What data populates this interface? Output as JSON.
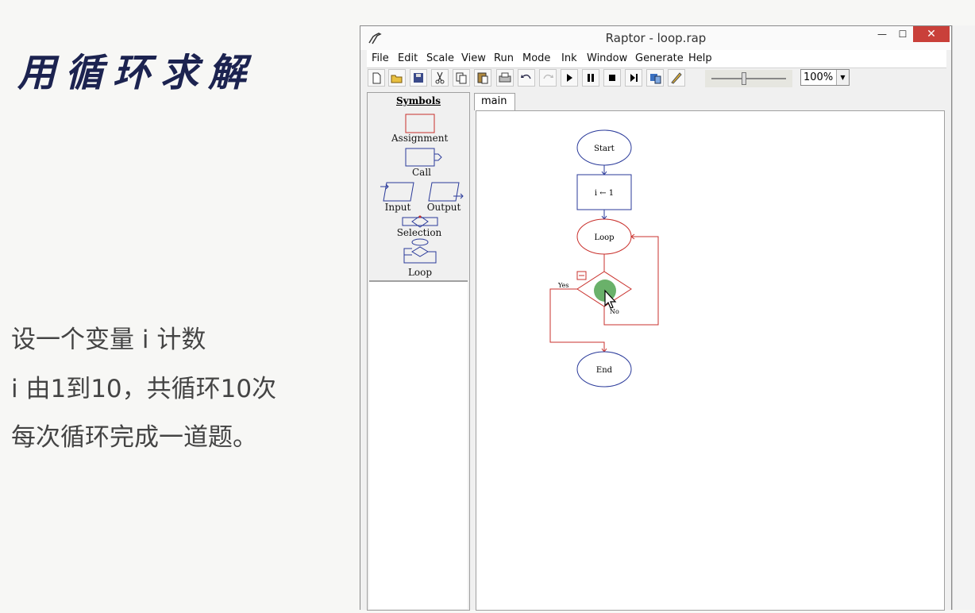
{
  "slide": {
    "title": "用循环求解",
    "lines": [
      "设一个变量 i 计数",
      "i 由1到10，共循环10次",
      "每次循环完成一道题。"
    ]
  },
  "window": {
    "title": "Raptor - loop.rap",
    "controls": {
      "minimize": "—",
      "maximize": "☐",
      "close": "✕"
    }
  },
  "menu": [
    "File",
    "Edit",
    "Scale",
    "View",
    "Run",
    "Mode",
    "Ink",
    "Window",
    "Generate",
    "Help"
  ],
  "toolbar": {
    "buttons": [
      "new-file-icon",
      "open-folder-icon",
      "save-icon",
      "cut-icon",
      "copy-icon",
      "paste-icon",
      "print-icon",
      "undo-icon",
      "redo-icon",
      "play-icon",
      "pause-icon",
      "stop-icon",
      "step-icon",
      "test-server-icon",
      "pen-icon"
    ],
    "zoom": "100%"
  },
  "symbols": {
    "header": "Symbols",
    "items": [
      "Assignment",
      "Call",
      "Input",
      "Output",
      "Selection",
      "Loop"
    ]
  },
  "tabs": [
    "main"
  ],
  "flowchart": {
    "start": "Start",
    "assignment": "i ← 1",
    "loop": "Loop",
    "yes": "Yes",
    "no": "No",
    "end": "End"
  },
  "colors": {
    "flow_blue": "#2a3a9a",
    "flow_red": "#c9302c",
    "close_button": "#c9403a",
    "cursor_highlight": "#5aa85a"
  }
}
